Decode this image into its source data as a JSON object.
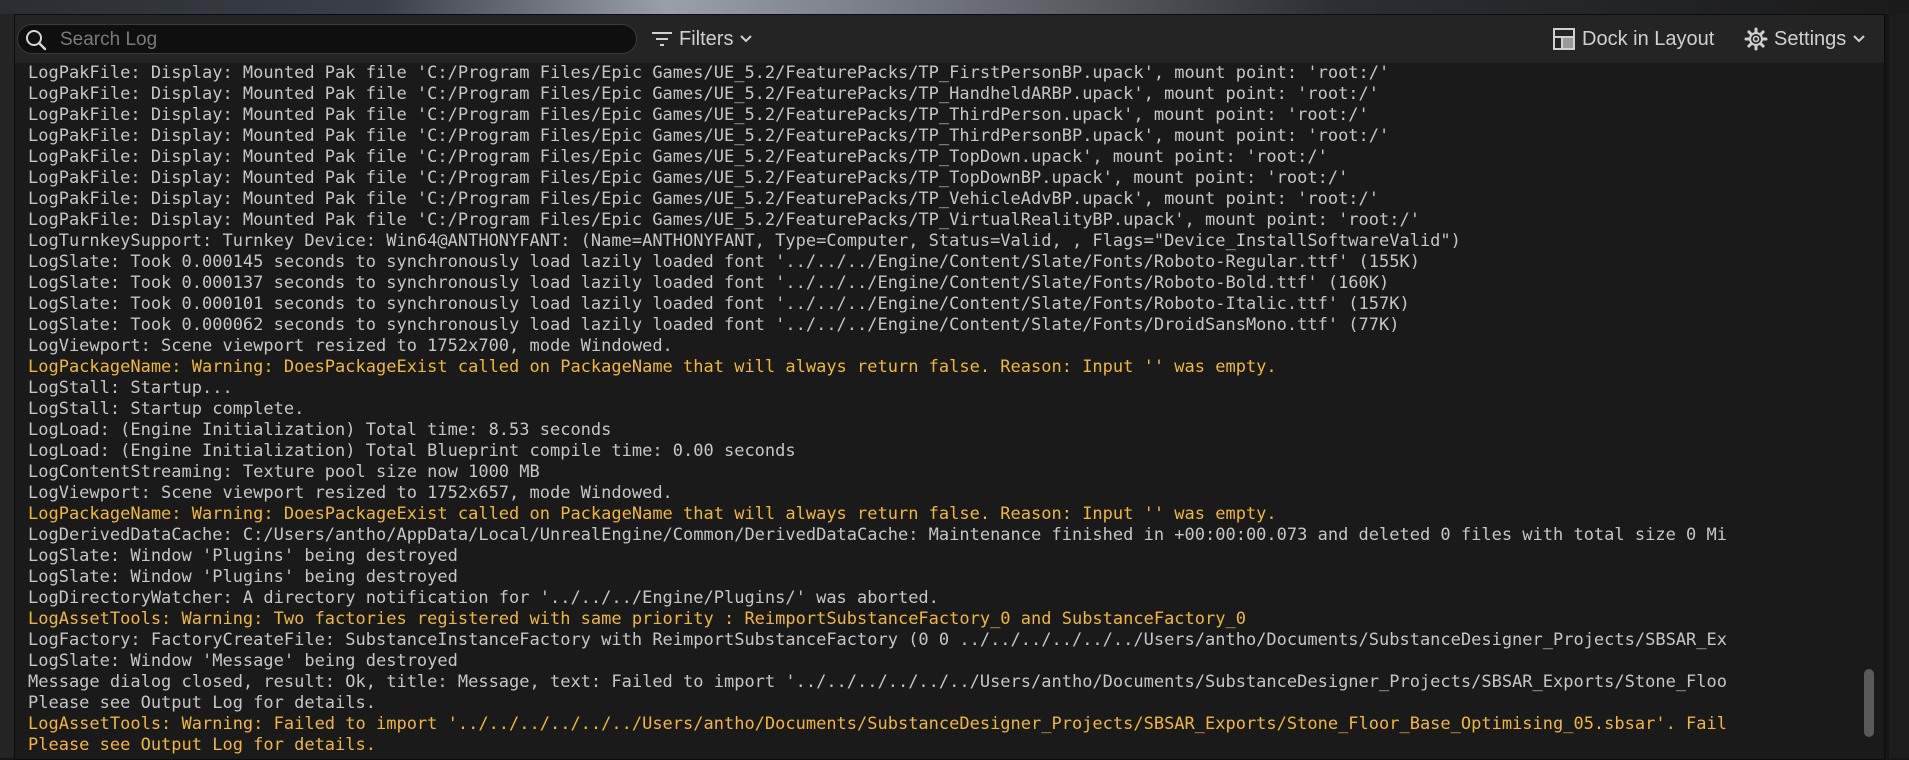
{
  "search": {
    "placeholder": "Search Log"
  },
  "toolbar": {
    "filters_label": "Filters",
    "dock_label": "Dock in Layout",
    "settings_label": "Settings"
  },
  "colors": {
    "warning": "#f2b63a",
    "normal": "#c6c6c6",
    "background": "#1a1a1a"
  },
  "icons": [
    "search-icon",
    "filter-icon",
    "chevron-down-icon",
    "dock-layout-icon",
    "gear-icon"
  ],
  "log": {
    "lines": [
      {
        "text": "LogPakFile: Display: Mounted Pak file 'C:/Program Files/Epic Games/UE_5.2/FeaturePacks/TP_FirstPersonBP.upack', mount point: 'root:/'",
        "level": "normal"
      },
      {
        "text": "LogPakFile: Display: Mounted Pak file 'C:/Program Files/Epic Games/UE_5.2/FeaturePacks/TP_HandheldARBP.upack', mount point: 'root:/'",
        "level": "normal"
      },
      {
        "text": "LogPakFile: Display: Mounted Pak file 'C:/Program Files/Epic Games/UE_5.2/FeaturePacks/TP_ThirdPerson.upack', mount point: 'root:/'",
        "level": "normal"
      },
      {
        "text": "LogPakFile: Display: Mounted Pak file 'C:/Program Files/Epic Games/UE_5.2/FeaturePacks/TP_ThirdPersonBP.upack', mount point: 'root:/'",
        "level": "normal"
      },
      {
        "text": "LogPakFile: Display: Mounted Pak file 'C:/Program Files/Epic Games/UE_5.2/FeaturePacks/TP_TopDown.upack', mount point: 'root:/'",
        "level": "normal"
      },
      {
        "text": "LogPakFile: Display: Mounted Pak file 'C:/Program Files/Epic Games/UE_5.2/FeaturePacks/TP_TopDownBP.upack', mount point: 'root:/'",
        "level": "normal"
      },
      {
        "text": "LogPakFile: Display: Mounted Pak file 'C:/Program Files/Epic Games/UE_5.2/FeaturePacks/TP_VehicleAdvBP.upack', mount point: 'root:/'",
        "level": "normal"
      },
      {
        "text": "LogPakFile: Display: Mounted Pak file 'C:/Program Files/Epic Games/UE_5.2/FeaturePacks/TP_VirtualRealityBP.upack', mount point: 'root:/'",
        "level": "normal"
      },
      {
        "text": "LogTurnkeySupport: Turnkey Device: Win64@ANTHONYFANT: (Name=ANTHONYFANT, Type=Computer, Status=Valid, , Flags=\"Device_InstallSoftwareValid\")",
        "level": "normal"
      },
      {
        "text": "LogSlate: Took 0.000145 seconds to synchronously load lazily loaded font '../../../Engine/Content/Slate/Fonts/Roboto-Regular.ttf' (155K)",
        "level": "normal"
      },
      {
        "text": "LogSlate: Took 0.000137 seconds to synchronously load lazily loaded font '../../../Engine/Content/Slate/Fonts/Roboto-Bold.ttf' (160K)",
        "level": "normal"
      },
      {
        "text": "LogSlate: Took 0.000101 seconds to synchronously load lazily loaded font '../../../Engine/Content/Slate/Fonts/Roboto-Italic.ttf' (157K)",
        "level": "normal"
      },
      {
        "text": "LogSlate: Took 0.000062 seconds to synchronously load lazily loaded font '../../../Engine/Content/Slate/Fonts/DroidSansMono.ttf' (77K)",
        "level": "normal"
      },
      {
        "text": "LogViewport: Scene viewport resized to 1752x700, mode Windowed.",
        "level": "normal"
      },
      {
        "text": "LogPackageName: Warning: DoesPackageExist called on PackageName that will always return false. Reason: Input '' was empty.",
        "level": "warning"
      },
      {
        "text": "LogStall: Startup...",
        "level": "normal"
      },
      {
        "text": "LogStall: Startup complete.",
        "level": "normal"
      },
      {
        "text": "LogLoad: (Engine Initialization) Total time: 8.53 seconds",
        "level": "normal"
      },
      {
        "text": "LogLoad: (Engine Initialization) Total Blueprint compile time: 0.00 seconds",
        "level": "normal"
      },
      {
        "text": "LogContentStreaming: Texture pool size now 1000 MB",
        "level": "normal"
      },
      {
        "text": "LogViewport: Scene viewport resized to 1752x657, mode Windowed.",
        "level": "normal"
      },
      {
        "text": "LogPackageName: Warning: DoesPackageExist called on PackageName that will always return false. Reason: Input '' was empty.",
        "level": "warning"
      },
      {
        "text": "LogDerivedDataCache: C:/Users/antho/AppData/Local/UnrealEngine/Common/DerivedDataCache: Maintenance finished in +00:00:00.073 and deleted 0 files with total size 0 Mi",
        "level": "normal"
      },
      {
        "text": "LogSlate: Window 'Plugins' being destroyed",
        "level": "normal"
      },
      {
        "text": "LogSlate: Window 'Plugins' being destroyed",
        "level": "normal"
      },
      {
        "text": "LogDirectoryWatcher: A directory notification for '../../../Engine/Plugins/' was aborted.",
        "level": "normal"
      },
      {
        "text": "LogAssetTools: Warning: Two factories registered with same priority : ReimportSubstanceFactory_0 and SubstanceFactory_0",
        "level": "warning"
      },
      {
        "text": "LogFactory: FactoryCreateFile: SubstanceInstanceFactory with ReimportSubstanceFactory (0 0 ../../../../../../Users/antho/Documents/SubstanceDesigner_Projects/SBSAR_Ex",
        "level": "normal"
      },
      {
        "text": "LogSlate: Window 'Message' being destroyed",
        "level": "normal"
      },
      {
        "text": "Message dialog closed, result: Ok, title: Message, text: Failed to import '../../../../../../Users/antho/Documents/SubstanceDesigner_Projects/SBSAR_Exports/Stone_Floo",
        "level": "normal"
      },
      {
        "text": "Please see Output Log for details.",
        "level": "normal"
      },
      {
        "text": "LogAssetTools: Warning: Failed to import '../../../../../../Users/antho/Documents/SubstanceDesigner_Projects/SBSAR_Exports/Stone_Floor_Base_Optimising_05.sbsar'. Fail",
        "level": "warning"
      },
      {
        "text": "Please see Output Log for details.",
        "level": "warning"
      }
    ]
  }
}
